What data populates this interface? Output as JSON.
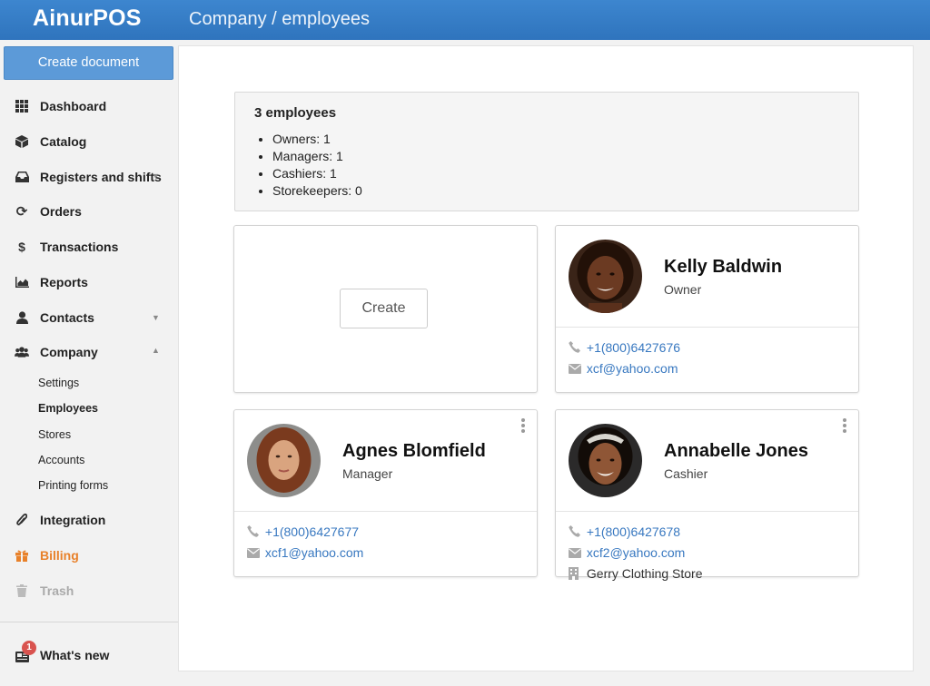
{
  "header": {
    "logo": "AinurPOS",
    "breadcrumb": "Company / employees"
  },
  "sidebar": {
    "create_document": "Create document",
    "items": [
      {
        "label": "Dashboard",
        "icon": "grid-icon"
      },
      {
        "label": "Catalog",
        "icon": "box-icon"
      },
      {
        "label": "Registers and shifts",
        "icon": "inbox-icon"
      },
      {
        "label": "Orders",
        "icon": "refresh-icon"
      },
      {
        "label": "Transactions",
        "icon": "dollar-icon"
      },
      {
        "label": "Reports",
        "icon": "area-chart-icon"
      },
      {
        "label": "Contacts",
        "icon": "user-icon"
      },
      {
        "label": "Company",
        "icon": "users-icon"
      },
      {
        "label": "Integration",
        "icon": "paperclip-icon"
      },
      {
        "label": "Billing",
        "icon": "gift-icon"
      },
      {
        "label": "Trash",
        "icon": "trash-icon"
      }
    ],
    "company_sub": [
      "Settings",
      "Employees",
      "Stores",
      "Accounts",
      "Printing forms"
    ],
    "active_sub": "Employees",
    "whats_new": {
      "label": "What's new",
      "badge": "1",
      "icon": "newspaper-icon"
    }
  },
  "summary": {
    "title": "3 employees",
    "items": [
      "Owners: 1",
      "Managers: 1",
      "Cashiers: 1",
      "Storekeepers: 0"
    ]
  },
  "create_card": {
    "button": "Create"
  },
  "employees": [
    {
      "name": "Kelly Baldwin",
      "role": "Owner",
      "phone": "+1(800)6427676",
      "email": "xcf@yahoo.com"
    },
    {
      "name": "Agnes Blomfield",
      "role": "Manager",
      "phone": "+1(800)6427677",
      "email": "xcf1@yahoo.com"
    },
    {
      "name": "Annabelle Jones",
      "role": "Cashier",
      "phone": "+1(800)6427678",
      "email": "xcf2@yahoo.com",
      "store": "Gerry Clothing Store"
    }
  ],
  "colors": {
    "header": "#2f74bd",
    "accent": "#3878c0",
    "billing": "#e8812a",
    "badge": "#d9534f"
  }
}
